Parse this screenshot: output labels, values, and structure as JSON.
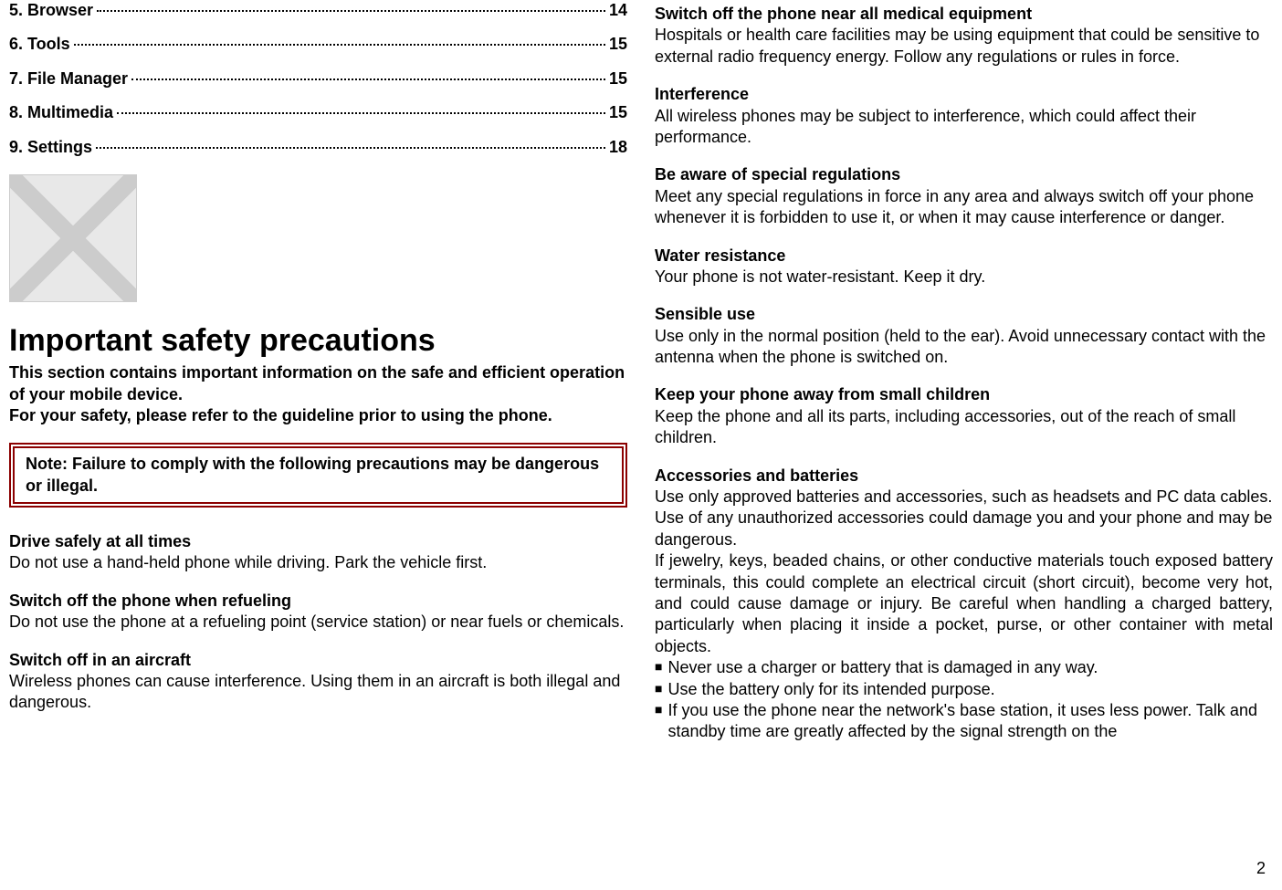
{
  "toc": [
    {
      "label": "5. Browser",
      "page": "14"
    },
    {
      "label": "6. Tools",
      "page": "15"
    },
    {
      "label": "7. File Manager",
      "page": "15"
    },
    {
      "label": "8. Multimedia",
      "page": "15"
    },
    {
      "label": "9. Settings",
      "page": "18"
    }
  ],
  "main_heading": "Important safety precautions",
  "intro_line1": "This section contains important information on the safe and efficient operation of your mobile device.",
  "intro_line2": "For your safety, please refer to the guideline prior to using the phone.",
  "note": {
    "label": "Note:",
    "text": " Failure to comply with the following precautions may be dangerous or illegal."
  },
  "left_sections": [
    {
      "heading": "Drive safely at all times",
      "body": "Do not use a hand-held phone while driving. Park the vehicle first."
    },
    {
      "heading": "Switch off the phone when refueling",
      "body": "Do not use the phone at a refueling point (service station) or near fuels or chemicals."
    },
    {
      "heading": "Switch off in an aircraft",
      "body": "Wireless phones can cause interference. Using them in an aircraft is both illegal and dangerous."
    }
  ],
  "right_sections": [
    {
      "heading": "Switch off the phone near all medical equipment",
      "body": "Hospitals or health care facilities may be using equipment that could be sensitive to external radio frequency energy. Follow any regulations or rules in force."
    },
    {
      "heading": "Interference",
      "body": "All wireless phones may be subject to interference, which could affect their performance."
    },
    {
      "heading": "Be aware of special regulations",
      "body": "Meet any special regulations in force in any area and always switch off your phone whenever it is forbidden to use it, or when it may cause interference or danger."
    },
    {
      "heading": "Water resistance",
      "body": "Your phone is not water-resistant. Keep it dry."
    },
    {
      "heading": "Sensible use",
      "body": "Use only in the normal position (held to the ear). Avoid unnecessary contact with the antenna when the phone is switched on."
    },
    {
      "heading": "Keep your phone away from small children",
      "body": "Keep the phone and all its parts, including accessories, out of the reach of small children."
    }
  ],
  "accessories": {
    "heading": "Accessories and batteries",
    "body1": "Use only approved batteries and accessories, such as headsets and PC data cables. Use of any unauthorized accessories could damage you and your phone and may be dangerous.",
    "body2": "If jewelry, keys, beaded chains, or other conductive materials touch exposed battery terminals, this could complete an electrical circuit (short circuit), become very hot, and could cause damage or injury. Be careful when handling a charged battery, particularly when placing it inside a pocket, purse, or other container with metal objects.",
    "bullets": [
      "Never use a charger or battery that is damaged in any way.",
      "Use the battery only for its intended purpose.",
      "If you use the phone near the network's base station, it uses less power. Talk and standby time are greatly affected by the signal strength on the"
    ]
  },
  "page_number": "2"
}
